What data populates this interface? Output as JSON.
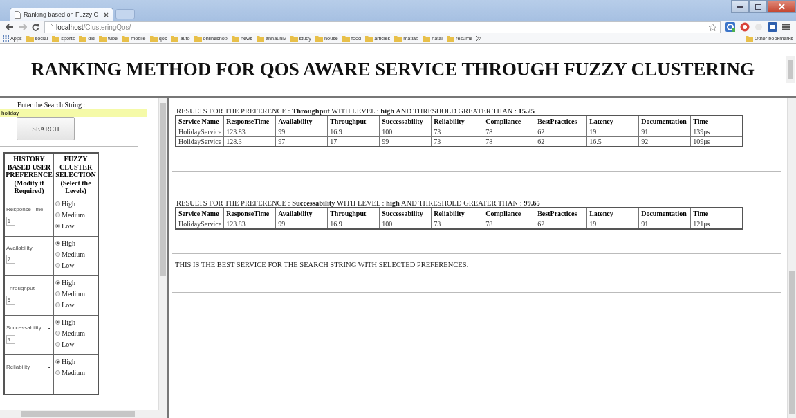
{
  "browser": {
    "tab_title": "Ranking based on Fuzzy C",
    "address_host": "localhost",
    "address_path": "/ClusteringQos/",
    "bookmarks": [
      {
        "kind": "apps",
        "label": "Apps"
      },
      {
        "kind": "folder",
        "label": "social"
      },
      {
        "kind": "folder",
        "label": "sports"
      },
      {
        "kind": "folder",
        "label": "dld"
      },
      {
        "kind": "folder",
        "label": "tube"
      },
      {
        "kind": "folder",
        "label": "mobile"
      },
      {
        "kind": "folder",
        "label": "qos"
      },
      {
        "kind": "folder",
        "label": "auto"
      },
      {
        "kind": "folder",
        "label": "onlineshop"
      },
      {
        "kind": "folder",
        "label": "news"
      },
      {
        "kind": "folder",
        "label": "annauniv"
      },
      {
        "kind": "folder",
        "label": "study"
      },
      {
        "kind": "folder",
        "label": "house"
      },
      {
        "kind": "folder",
        "label": "food"
      },
      {
        "kind": "folder",
        "label": "articles"
      },
      {
        "kind": "folder",
        "label": "matlab"
      },
      {
        "kind": "folder",
        "label": "natal"
      },
      {
        "kind": "folder",
        "label": "resume"
      }
    ],
    "other_bookmarks": "Other bookmarks"
  },
  "page": {
    "title": "RANKING METHOD FOR QOS AWARE SERVICE THROUGH FUZZY CLUSTERING",
    "search": {
      "label": "Enter the Search String :",
      "value": "holiday",
      "button": "SEARCH"
    },
    "preference_table": {
      "columns": [
        "HISTORY BASED USER PREFERENCE (Modify if Required)",
        "FUZZY CLUSTER SELECTION (Select the Levels)"
      ],
      "rows": [
        {
          "name": "ResponseTime",
          "marker": "-",
          "value": "1",
          "options": [
            {
              "label": "High",
              "selected": false
            },
            {
              "label": "Medium",
              "selected": false
            },
            {
              "label": "Low",
              "selected": true
            }
          ]
        },
        {
          "name": "Availability",
          "value": "7",
          "options": [
            {
              "label": "High",
              "selected": true
            },
            {
              "label": "Medium",
              "selected": false
            },
            {
              "label": "Low",
              "selected": false
            }
          ]
        },
        {
          "name": "Throughput",
          "marker": "-",
          "value": "5",
          "options": [
            {
              "label": "High",
              "selected": true
            },
            {
              "label": "Medium",
              "selected": false
            },
            {
              "label": "Low",
              "selected": false
            }
          ]
        },
        {
          "name": "Successability",
          "marker": "-",
          "value": "4",
          "options": [
            {
              "label": "High",
              "selected": true
            },
            {
              "label": "Medium",
              "selected": false
            },
            {
              "label": "Low",
              "selected": false
            }
          ]
        },
        {
          "name": "Reliability",
          "marker": "-",
          "options": [
            {
              "label": "High",
              "selected": true
            },
            {
              "label": "Medium",
              "selected": false
            }
          ]
        }
      ]
    },
    "results": [
      {
        "heading": "RESULTS FOR THE PREFERENCE : **Throughput** WITH LEVEL : **high** AND THRESHOLD GREATER THAN : **15.25**",
        "columns": [
          "Service Name",
          "ResponseTime",
          "Availability",
          "Throughput",
          "Successability",
          "Reliability",
          "Compliance",
          "BestPractices",
          "Latency",
          "Documentation",
          "Time"
        ],
        "rows": [
          [
            "HolidayService",
            "123.83",
            "99",
            "16.9",
            "100",
            "73",
            "78",
            "62",
            "19",
            "91",
            "139μs"
          ],
          [
            "HolidayService",
            "128.3",
            "97",
            "17",
            "99",
            "73",
            "78",
            "62",
            "16.5",
            "92",
            "109μs"
          ]
        ]
      },
      {
        "heading": "RESULTS FOR THE PREFERENCE : **Successability** WITH LEVEL : **high** AND THRESHOLD GREATER THAN : **99.65**",
        "columns": [
          "Service Name",
          "ResponseTime",
          "Availability",
          "Throughput",
          "Successability",
          "Reliability",
          "Compliance",
          "BestPractices",
          "Latency",
          "Documentation",
          "Time"
        ],
        "rows": [
          [
            "HolidayService",
            "123.83",
            "99",
            "16.9",
            "100",
            "73",
            "78",
            "62",
            "19",
            "91",
            "121μs"
          ]
        ]
      }
    ],
    "conclusion": "THIS IS THE BEST SERVICE FOR THE SEARCH STRING WITH SELECTED PREFERENCES."
  }
}
